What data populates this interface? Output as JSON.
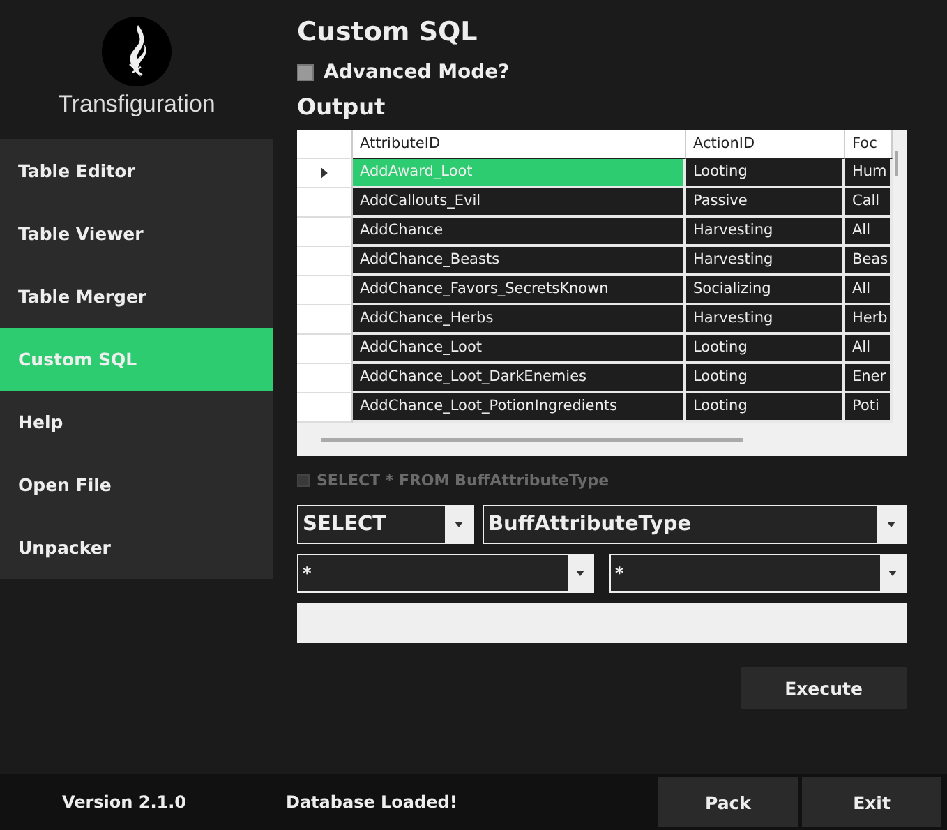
{
  "app": {
    "name": "Transfiguration"
  },
  "sidebar": {
    "items": [
      {
        "label": "Table Editor",
        "selected": false
      },
      {
        "label": "Table Viewer",
        "selected": false
      },
      {
        "label": "Table Merger",
        "selected": false
      },
      {
        "label": "Custom SQL",
        "selected": true
      },
      {
        "label": "Help",
        "selected": false
      },
      {
        "label": "Open File",
        "selected": false
      },
      {
        "label": "Unpacker",
        "selected": false
      }
    ]
  },
  "page": {
    "title": "Custom SQL",
    "advanced_mode": {
      "label": "Advanced Mode?",
      "checked": false
    },
    "output_label": "Output"
  },
  "table": {
    "columns": [
      "AttributeID",
      "ActionID",
      "Foc"
    ],
    "rows": [
      {
        "cells": [
          "AddAward_Loot",
          "Looting",
          "Hum"
        ],
        "selected": true
      },
      {
        "cells": [
          "AddCallouts_Evil",
          "Passive",
          "Call"
        ],
        "selected": false
      },
      {
        "cells": [
          "AddChance",
          "Harvesting",
          "All"
        ],
        "selected": false
      },
      {
        "cells": [
          "AddChance_Beasts",
          "Harvesting",
          "Beas"
        ],
        "selected": false
      },
      {
        "cells": [
          "AddChance_Favors_SecretsKnown",
          "Socializing",
          "All"
        ],
        "selected": false
      },
      {
        "cells": [
          "AddChance_Herbs",
          "Harvesting",
          "Herb"
        ],
        "selected": false
      },
      {
        "cells": [
          "AddChance_Loot",
          "Looting",
          "All"
        ],
        "selected": false
      },
      {
        "cells": [
          "AddChance_Loot_DarkEnemies",
          "Looting",
          "Ener"
        ],
        "selected": false
      },
      {
        "cells": [
          "AddChance_Loot_PotionIngredients",
          "Looting",
          "Poti"
        ],
        "selected": false
      }
    ]
  },
  "query_preview": {
    "label": "SELECT * FROM BuffAttributeType",
    "checked": false,
    "disabled": true
  },
  "query": {
    "statement": "SELECT",
    "table": "BuffAttributeType",
    "field_1": "*",
    "field_2": "*"
  },
  "execute_button": "Execute",
  "status_bar": {
    "version": "Version 2.1.0",
    "status": "Database Loaded!",
    "buttons": [
      "Pack",
      "Exit"
    ]
  }
}
